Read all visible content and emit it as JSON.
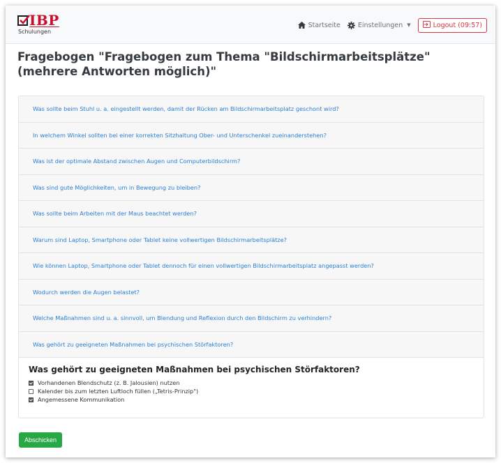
{
  "brand": {
    "name": "IBP",
    "subtitle": "Schulungen"
  },
  "nav": {
    "home_label": "Startseite",
    "settings_label": "Einstellungen",
    "logout_label": "Logout (09:57)"
  },
  "page": {
    "title": "Fragebogen \"Fragebogen zum Thema \"Bildschirmarbeitsplätze\" (mehrere Antworten möglich)\""
  },
  "questions": [
    "Was sollte beim Stuhl u. a. eingestellt werden, damit der Rücken am Bildschirmarbeitsplatz geschont wird?",
    "In welchem Winkel sollten bei einer korrekten Sitzhaltung Ober- und Unterschenkel zueinanderstehen?",
    "Was ist der optimale Abstand zwischen Augen und Computerbildschirm?",
    "Was sind gute Möglichkeiten, um in Bewegung zu bleiben?",
    "Was sollte beim Arbeiten mit der Maus beachtet werden?",
    "Warum sind Laptop, Smartphone oder Tablet keine vollwertigen Bildschirmarbeitsplätze?",
    "Wie können Laptop, Smartphone oder Tablet dennoch für einen vollwertigen Bildschirmarbeitsplatz angepasst werden?",
    "Wodurch werden die Augen belastet?",
    "Welche Maßnahmen sind u. a. sinnvoll, um Blendung und Reflexion durch den Bildschirm zu verhindern?",
    "Was gehört zu geeigneten Maßnahmen bei psychischen Störfaktoren?"
  ],
  "active_question": {
    "heading": "Was gehört zu geeigneten Maßnahmen bei psychischen Störfaktoren?",
    "options": [
      {
        "label": "Vorhandenen Blendschutz (z. B. Jalousien) nutzen",
        "checked": true
      },
      {
        "label": "Kalender bis zum letzten Luftloch füllen („Tetris-Prinzip\")",
        "checked": false
      },
      {
        "label": "Angemessene Kommunikation",
        "checked": true
      }
    ]
  },
  "submit_label": "Abschicken",
  "colors": {
    "link": "#2a7fd4",
    "danger": "#dc3545",
    "success": "#28a745",
    "brand": "#c8102e"
  }
}
